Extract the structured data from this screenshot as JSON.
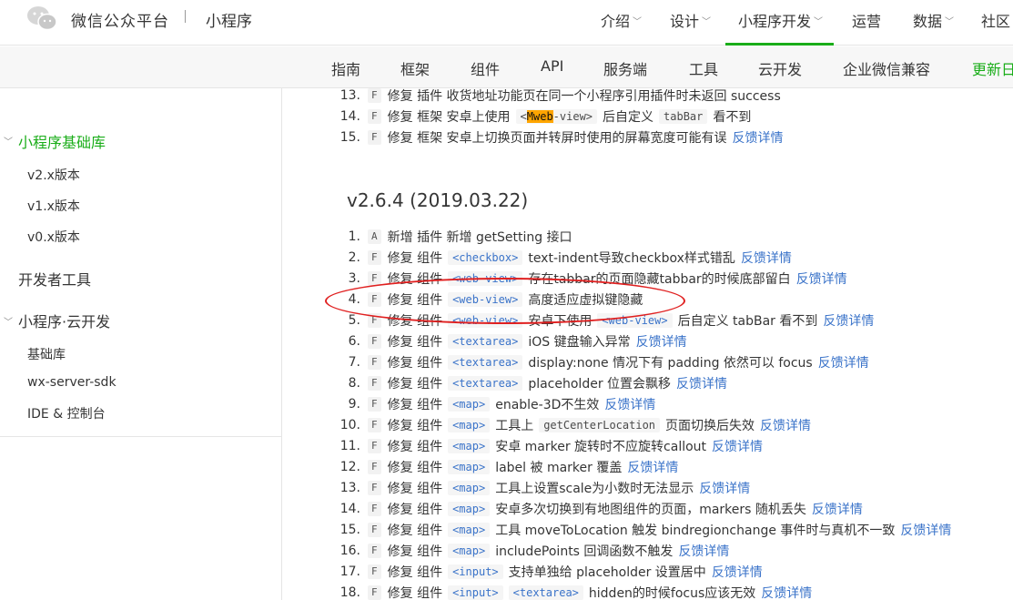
{
  "topbar": {
    "brand": "微信公众平台",
    "brand_sub": "小程序",
    "nav": [
      {
        "label": "介绍",
        "chevron": "﹀"
      },
      {
        "label": "设计",
        "chevron": "﹀"
      },
      {
        "label": "小程序开发",
        "chevron": "﹀"
      },
      {
        "label": "运营",
        "chevron": ""
      },
      {
        "label": "数据",
        "chevron": "﹀"
      },
      {
        "label": "社区",
        "chevron": ""
      }
    ]
  },
  "subnav": [
    "指南",
    "框架",
    "组件",
    "API",
    "服务端",
    "工具",
    "云开发",
    "企业微信兼容",
    "更新日"
  ],
  "sidebar": {
    "items": [
      {
        "label": "小程序基础库",
        "caret": "﹀"
      },
      {
        "label": "v2.x版本"
      },
      {
        "label": "v1.x版本"
      },
      {
        "label": "v0.x版本"
      },
      {
        "label": "开发者工具"
      },
      {
        "label": "小程序·云开发",
        "caret": "﹀"
      },
      {
        "label": "基础库"
      },
      {
        "label": "wx-server-sdk"
      },
      {
        "label": "IDE & 控制台"
      }
    ]
  },
  "main": {
    "prev_rows": [
      {
        "num": "13.",
        "tag": "F",
        "text": "修复 插件 收货地址功能页在同一个小程序引用插件时未返回 success"
      },
      {
        "num": "14.",
        "tag": "F",
        "text": "修复 框架 安卓上使用",
        "code_pre": "<",
        "code_hl": "Mweb",
        "code_post": "-view>",
        "text2": "后自定义",
        "code2": "tabBar",
        "text3": "看不到"
      },
      {
        "num": "15.",
        "tag": "F",
        "text": "修复 框架 安卓上切换页面并转屏时使用的屏幕宽度可能有误",
        "link": "反馈详情"
      }
    ],
    "version_title": "v2.6.4 (2019.03.22)",
    "rows": [
      {
        "num": "1.",
        "tag": "A",
        "text": "新增 插件 新增 getSetting 接口"
      },
      {
        "num": "2.",
        "tag": "F",
        "text": "修复 组件",
        "code": "<checkbox>",
        "text2": "text-indent导致checkbox样式错乱",
        "link": "反馈详情"
      },
      {
        "num": "3.",
        "tag": "F",
        "text": "修复 组件",
        "code": "<web-view>",
        "text2": "存在tabbar的页面隐藏tabbar的时候底部留白",
        "link": "反馈详情"
      },
      {
        "num": "4.",
        "tag": "F",
        "text": "修复 组件",
        "code": "<web-view>",
        "text2": "高度适应虚拟键隐藏"
      },
      {
        "num": "5.",
        "tag": "F",
        "text": "修复 组件",
        "code": "<web-view>",
        "text2": "安卓下使用",
        "code2": "<web-view>",
        "text3": "后自定义 tabBar 看不到",
        "link": "反馈详情"
      },
      {
        "num": "6.",
        "tag": "F",
        "text": "修复 组件",
        "code": "<textarea>",
        "text2": "iOS 键盘输入异常",
        "link": "反馈详情"
      },
      {
        "num": "7.",
        "tag": "F",
        "text": "修复 组件",
        "code": "<textarea>",
        "text2": "display:none 情况下有 padding 依然可以 focus",
        "link": "反馈详情"
      },
      {
        "num": "8.",
        "tag": "F",
        "text": "修复 组件",
        "code": "<textarea>",
        "text2": "placeholder 位置会飘移",
        "link": "反馈详情"
      },
      {
        "num": "9.",
        "tag": "F",
        "text": "修复 组件",
        "code": "<map>",
        "text2": "enable-3D不生效",
        "link": "反馈详情"
      },
      {
        "num": "10.",
        "tag": "F",
        "text": "修复 组件",
        "code": "<map>",
        "text2": "工具上",
        "code2_plain": "getCenterLocation",
        "text3": "页面切换后失效",
        "link": "反馈详情"
      },
      {
        "num": "11.",
        "tag": "F",
        "text": "修复 组件",
        "code": "<map>",
        "text2": "安卓 marker 旋转时不应旋转callout",
        "link": "反馈详情"
      },
      {
        "num": "12.",
        "tag": "F",
        "text": "修复 组件",
        "code": "<map>",
        "text2": "label 被 marker 覆盖",
        "link": "反馈详情"
      },
      {
        "num": "13.",
        "tag": "F",
        "text": "修复 组件",
        "code": "<map>",
        "text2": "工具上设置scale为小数时无法显示",
        "link": "反馈详情"
      },
      {
        "num": "14.",
        "tag": "F",
        "text": "修复 组件",
        "code": "<map>",
        "text2": "安卓多次切换到有地图组件的页面，markers 随机丢失",
        "link": "反馈详情"
      },
      {
        "num": "15.",
        "tag": "F",
        "text": "修复 组件",
        "code": "<map>",
        "text2": "工具 moveToLocation 触发 bindregionchange 事件时与真机不一致",
        "link": "反馈详情"
      },
      {
        "num": "16.",
        "tag": "F",
        "text": "修复 组件",
        "code": "<map>",
        "text2": "includePoints 回调函数不触发",
        "link": "反馈详情"
      },
      {
        "num": "17.",
        "tag": "F",
        "text": "修复 组件",
        "code": "<input>",
        "text2": "支持单独给 placeholder 设置居中",
        "link": "反馈详情"
      },
      {
        "num": "18.",
        "tag": "F",
        "text": "修复 组件",
        "code": "<input>",
        "code2": "<textarea>",
        "text3": "hidden的时候focus应该无效",
        "link": "反馈详情"
      }
    ]
  },
  "colors": {
    "accent_green": "#1aad19",
    "link_blue": "#3a73c9",
    "highlight_orange": "#ffa500",
    "annotation_red": "#e02020"
  }
}
